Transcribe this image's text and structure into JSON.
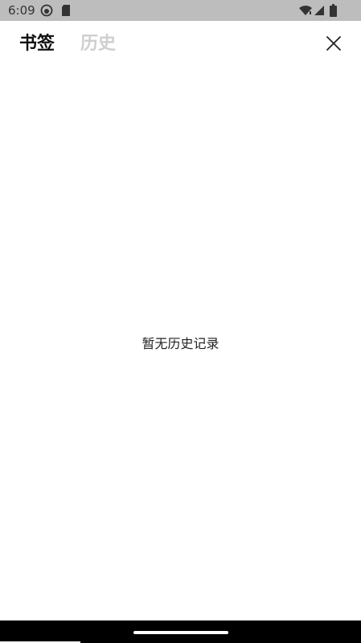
{
  "status_bar": {
    "time": "6:09",
    "icons": [
      "record-icon",
      "sd-card-icon",
      "wifi-icon",
      "signal-icon",
      "battery-icon"
    ]
  },
  "tabs": [
    {
      "label": "书签",
      "active": true
    },
    {
      "label": "历史",
      "active": false
    }
  ],
  "close_icon": "close-icon",
  "empty_state": {
    "message": "暂无历史记录"
  },
  "colors": {
    "status_bar_bg": "#bdbdbd",
    "active_tab": "#111111",
    "inactive_tab": "#cfcfcf",
    "nav_bar_bg": "#000000"
  }
}
